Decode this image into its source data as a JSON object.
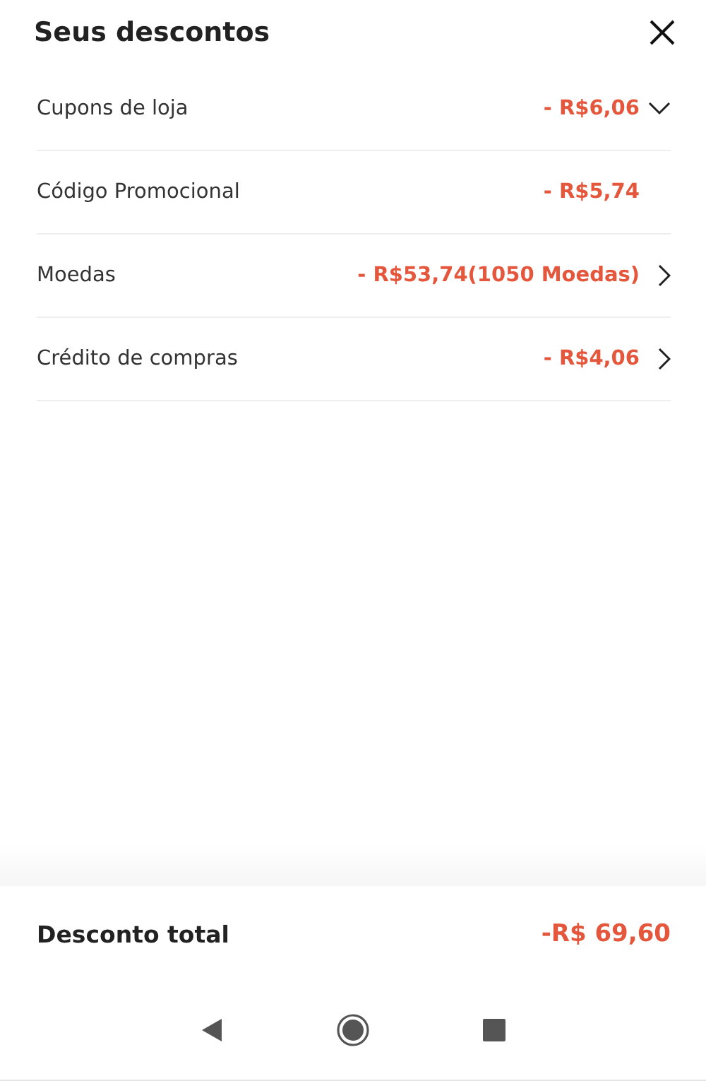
{
  "header": {
    "title": "Seus descontos"
  },
  "discounts": [
    {
      "label": "Cupons de loja",
      "amount": "- R$6,06",
      "kind": "expand"
    },
    {
      "label": "Código Promocional",
      "amount": "- R$5,74",
      "kind": "plain"
    },
    {
      "label": "Moedas",
      "amount": "- R$53,74(1050 Moedas)",
      "kind": "link"
    },
    {
      "label": "Crédito de compras",
      "amount": "- R$4,06",
      "kind": "link"
    }
  ],
  "footer": {
    "label": "Desconto total",
    "amount": "-R$ 69,60"
  }
}
